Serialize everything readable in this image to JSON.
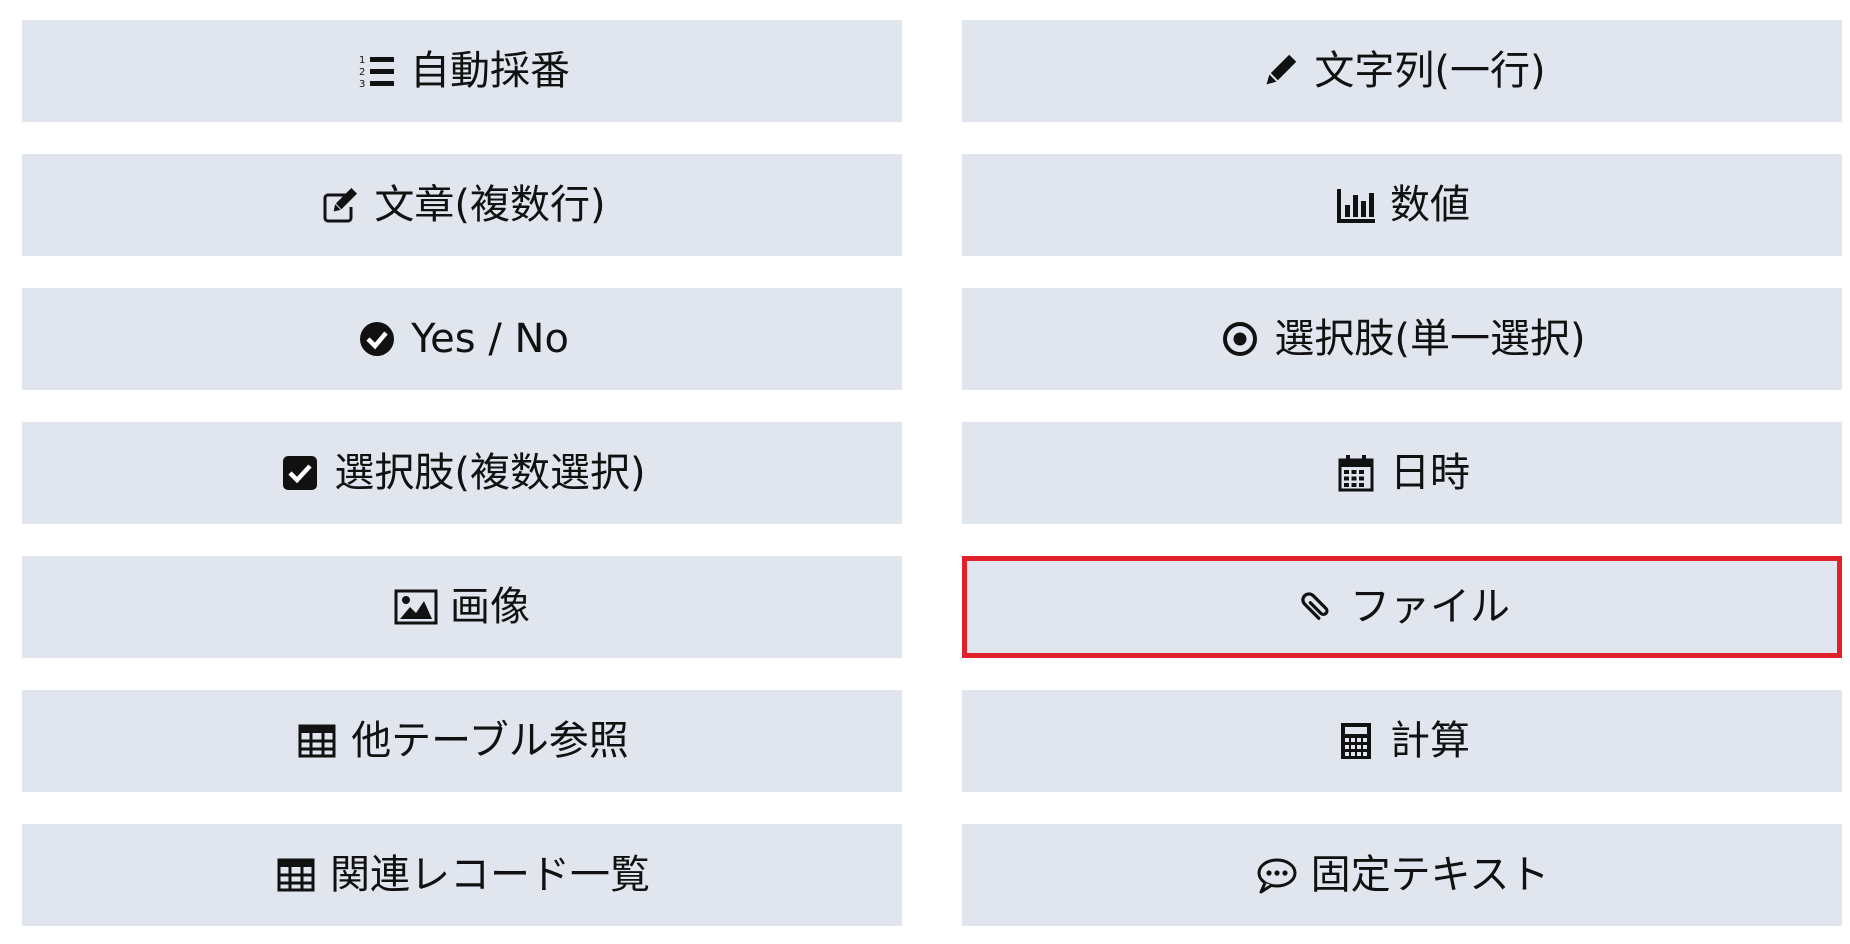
{
  "field_types": [
    {
      "id": "autonumber",
      "label": "自動採番",
      "icon": "list-ol-icon"
    },
    {
      "id": "text-single",
      "label": "文字列(一行)",
      "icon": "pencil-icon"
    },
    {
      "id": "text-multi",
      "label": "文章(複数行)",
      "icon": "edit-icon"
    },
    {
      "id": "number",
      "label": "数値",
      "icon": "bar-chart-icon"
    },
    {
      "id": "yes-no",
      "label": "Yes / No",
      "icon": "check-circle-icon"
    },
    {
      "id": "single-select",
      "label": "選択肢(単一選択)",
      "icon": "dot-circle-icon"
    },
    {
      "id": "multi-select",
      "label": "選択肢(複数選択)",
      "icon": "check-square-icon"
    },
    {
      "id": "datetime",
      "label": "日時",
      "icon": "calendar-icon"
    },
    {
      "id": "image",
      "label": "画像",
      "icon": "image-icon"
    },
    {
      "id": "file",
      "label": "ファイル",
      "icon": "paperclip-icon",
      "selected": true
    },
    {
      "id": "lookup",
      "label": "他テーブル参照",
      "icon": "table-icon"
    },
    {
      "id": "calc",
      "label": "計算",
      "icon": "calculator-icon"
    },
    {
      "id": "related-list",
      "label": "関連レコード一覧",
      "icon": "table-icon"
    },
    {
      "id": "fixed-text",
      "label": "固定テキスト",
      "icon": "comment-dots-icon"
    }
  ],
  "colors": {
    "button_bg": "#e1e6ee",
    "text": "#111111",
    "selected_border": "#e0202a"
  }
}
